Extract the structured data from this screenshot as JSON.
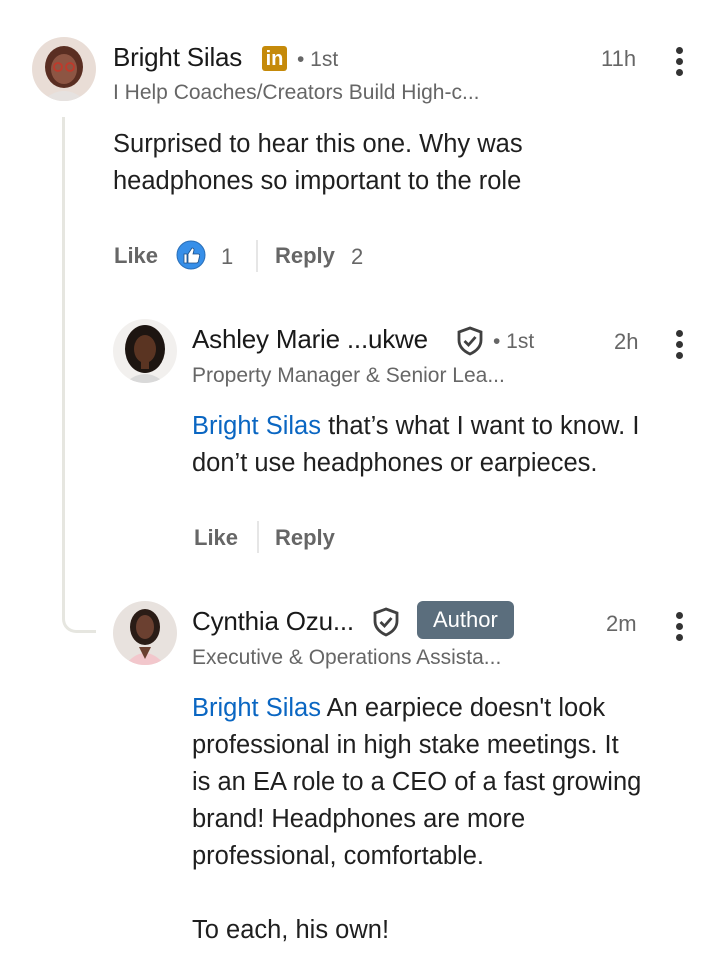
{
  "comments": [
    {
      "author": "Bright Silas",
      "badge_text": "in",
      "degree": "• 1st",
      "headline": "I Help Coaches/Creators Build High-c...",
      "time": "11h",
      "body": "Surprised to hear this one. Why was headphones so important to the role",
      "like_label": "Like",
      "like_count": "1",
      "reply_label": "Reply",
      "reply_count": "2",
      "reactions": [
        "like-reaction-icon"
      ]
    },
    {
      "author": "Ashley Marie ...ukwe",
      "degree": "• 1st",
      "headline": "Property Manager & Senior Lea...",
      "time": "2h",
      "mention": "Bright Silas",
      "body_line1": " that’s what I want to know. I",
      "body_line2": "don’t use headphones or earpieces.",
      "like_label": "Like",
      "reply_label": "Reply",
      "verified_icon": "verified-shield-icon"
    },
    {
      "author": "Cynthia Ozu...",
      "author_badge": "Author",
      "headline": "Executive & Operations Assista...",
      "time": "2m",
      "mention": "Bright Silas",
      "body_line1": " An earpiece doesn't look",
      "body_line2": "professional in high stake meetings. It",
      "body_line3": "is an EA role to a CEO of a fast growing",
      "body_line4": "brand! Headphones are more",
      "body_line5": "professional, comfortable.",
      "body_line6": "To each, his own!",
      "verified_icon": "verified-shield-icon"
    }
  ],
  "colors": {
    "mention": "#0a66c2",
    "like_reaction": "#378fe9",
    "author_badge": "#5b6e7d",
    "premium_badge": "#c58a0a"
  }
}
